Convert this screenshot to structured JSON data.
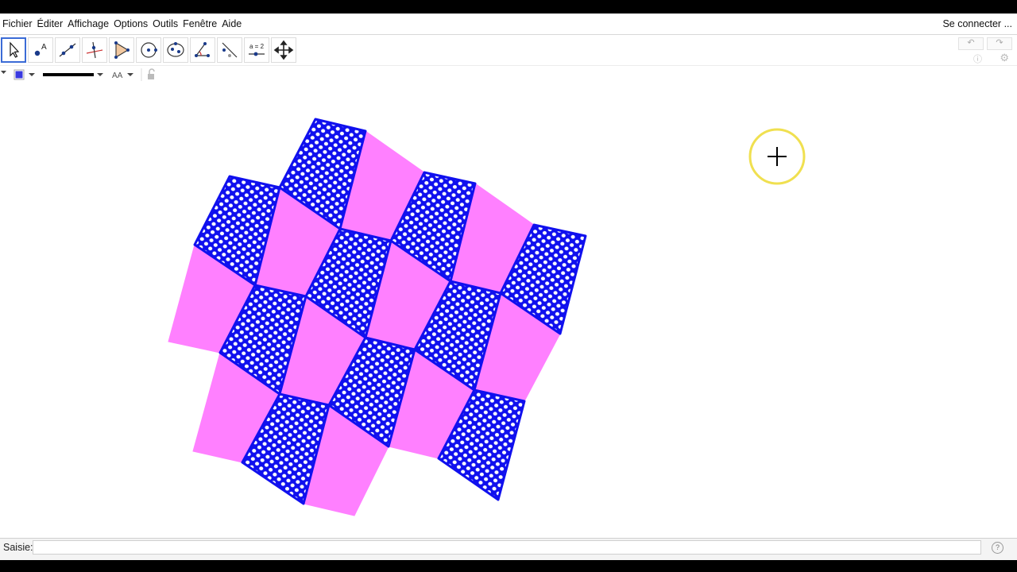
{
  "menubar": {
    "items": [
      "Fichier",
      "Éditer",
      "Affichage",
      "Options",
      "Outils",
      "Fenêtre",
      "Aide"
    ],
    "login": "Se connecter ..."
  },
  "toolbar": {
    "tools": [
      {
        "name": "move-tool",
        "active": true
      },
      {
        "name": "point-tool",
        "active": false
      },
      {
        "name": "line-tool",
        "active": false
      },
      {
        "name": "perpendicular-line-tool",
        "active": false
      },
      {
        "name": "polygon-tool",
        "active": false
      },
      {
        "name": "circle-tool",
        "active": false
      },
      {
        "name": "ellipse-tool",
        "active": false
      },
      {
        "name": "angle-tool",
        "active": false
      },
      {
        "name": "reflect-tool",
        "active": false
      },
      {
        "name": "slider-tool",
        "active": false
      },
      {
        "name": "move-view-tool",
        "active": false
      }
    ],
    "slider_label": "a = 2",
    "undo_icon": "undo-icon",
    "redo_icon": "redo-icon",
    "help_icon": "help-icon",
    "settings_icon": "gear-icon"
  },
  "stylebar": {
    "color": "#3a3ae0",
    "text_size_label": "AA",
    "lock_icon": "unlock-icon"
  },
  "graphics": {
    "quad_fill_color": "#ff80ff",
    "hex_tile_color": "#1010ee",
    "cursor_highlight": "#f0e050"
  },
  "input_bar": {
    "label": "Saisie:",
    "value": "",
    "help_icon": "help-icon"
  }
}
